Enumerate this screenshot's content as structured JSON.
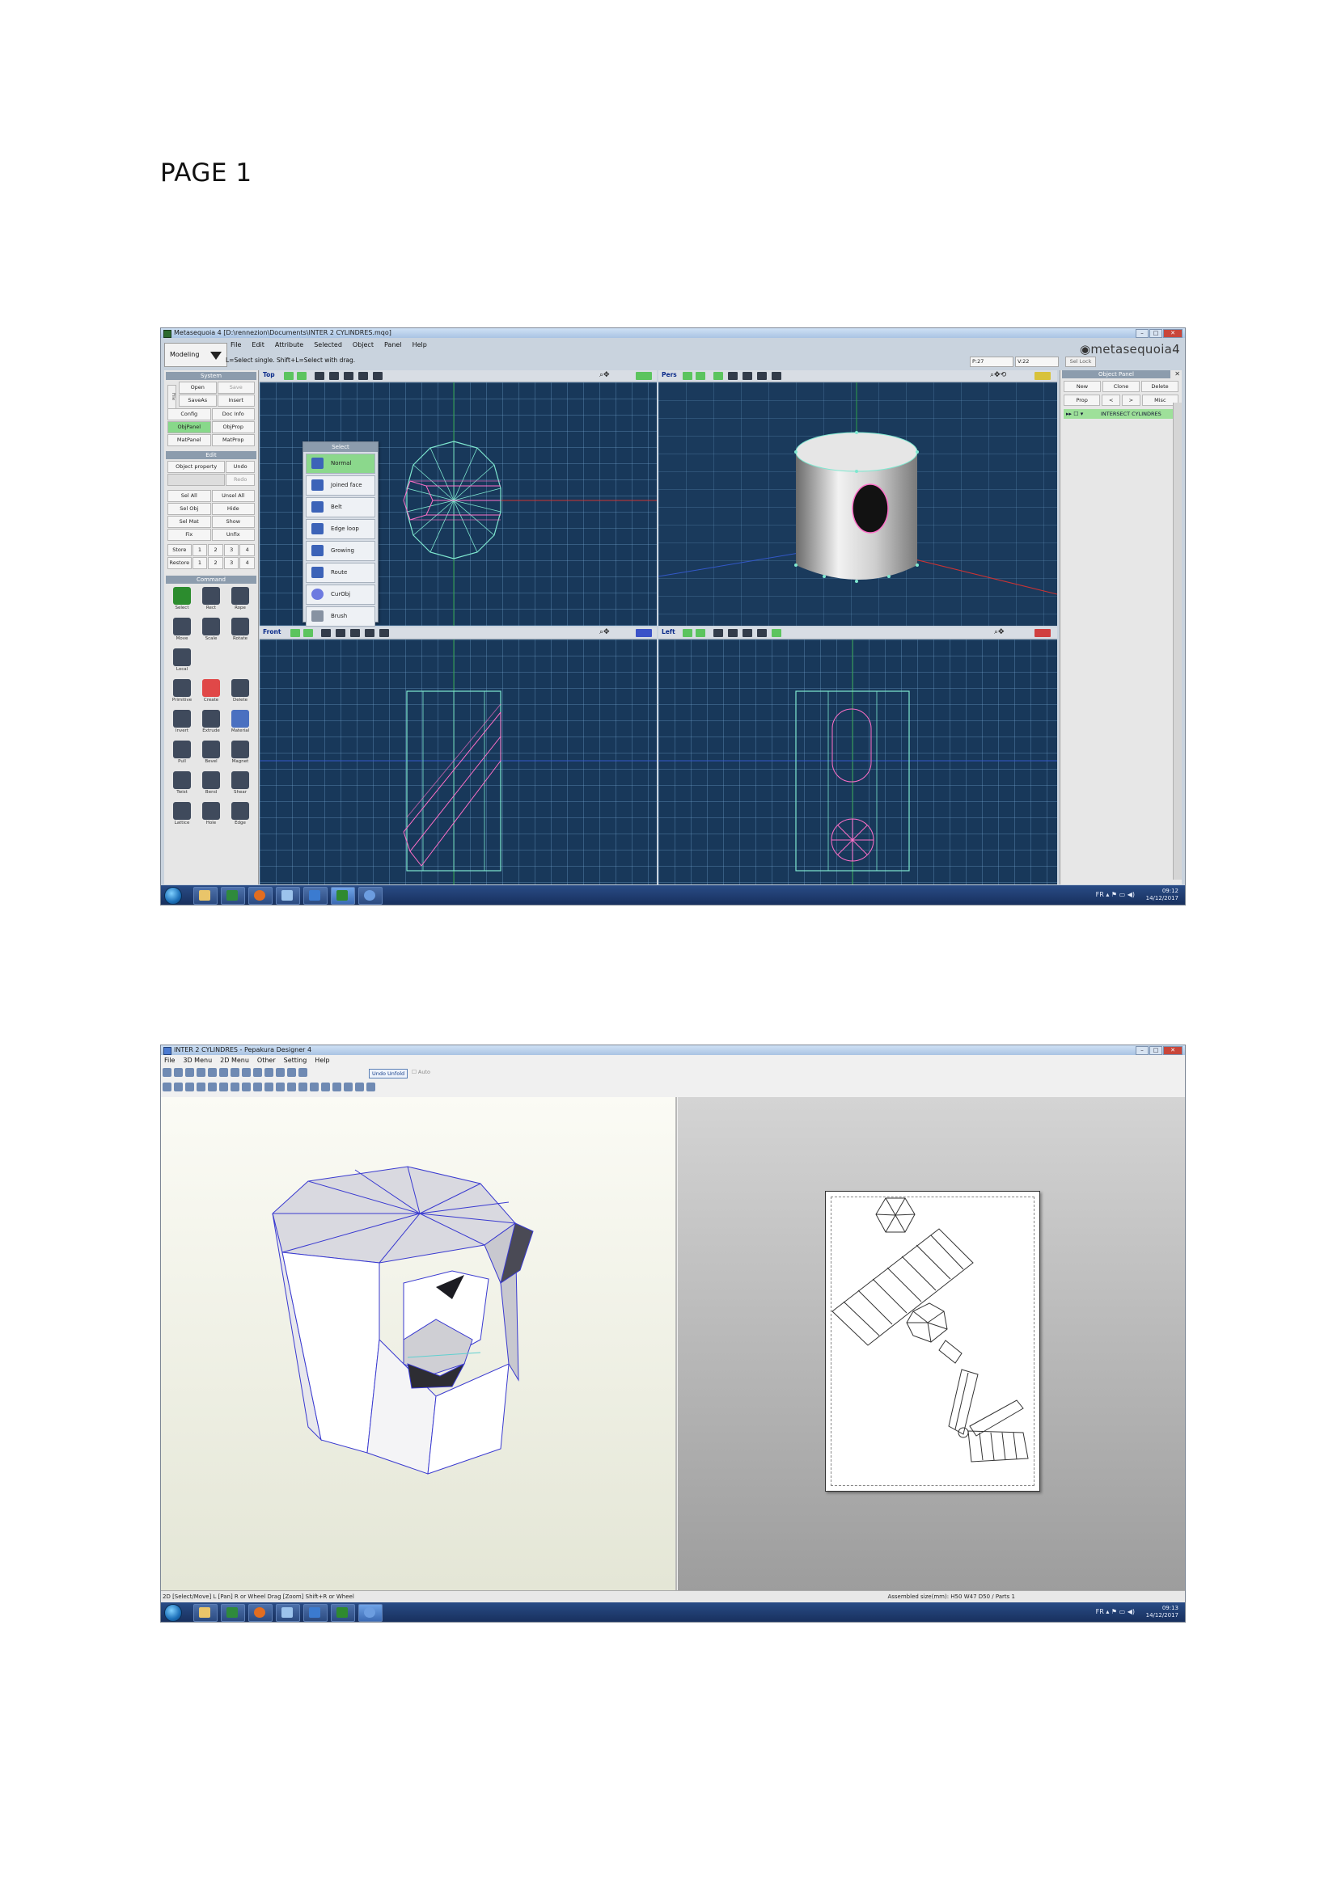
{
  "page": {
    "label": "PAGE 1"
  },
  "metasequoia": {
    "title": "Metasequoia 4 [D:\\rennezion\\Documents\\INTER 2 CYLINDRES.mqo]",
    "menu": [
      "File",
      "Edit",
      "Attribute",
      "Selected",
      "Object",
      "Panel",
      "Help"
    ],
    "mode": "Modeling",
    "status": "L=Select single.  Shift+L=Select with drag.",
    "coord_p": "P:27",
    "coord_v": "V:22",
    "sel_lock": "Sel Lock",
    "logo": "metasequoia",
    "logo_version": "4",
    "system": {
      "head": "System",
      "file_label": "File",
      "buttons": [
        "Open",
        "Save",
        "SaveAs",
        "Insert",
        "Config",
        "Doc Info",
        "ObjPanel",
        "ObjProp",
        "MatPanel",
        "MatProp"
      ]
    },
    "edit": {
      "head": "Edit",
      "buttons": [
        "Object property",
        "Undo",
        "",
        "Redo",
        "Sel All",
        "Unsel All",
        "Sel Obj",
        "Hide",
        "Sel Mat",
        "Show",
        "Fix",
        "Unfix"
      ],
      "store_label": "Store",
      "restore_label": "Restore",
      "slots": [
        "1",
        "2",
        "3",
        "4"
      ]
    },
    "command": {
      "head": "Command",
      "tools": [
        "Select",
        "Rect",
        "Rope",
        "Move",
        "Scale",
        "Rotate",
        "Local",
        "",
        "",
        "Primitive",
        "Create",
        "Delete",
        "Invert",
        "Extrude",
        "Material",
        "Pull",
        "Bevel",
        "Magnet",
        "Twist",
        "Bend",
        "Shear",
        "Lattice",
        "Hole",
        "Edge"
      ]
    },
    "viewports": {
      "top": "Top",
      "pers": "Pers",
      "front": "Front",
      "left": "Left"
    },
    "select_menu": {
      "head": "Select",
      "items": [
        "Normal",
        "Joined face",
        "Belt",
        "Edge loop",
        "Growing",
        "Route",
        "CurObj",
        "Brush"
      ]
    },
    "object_panel": {
      "head": "Object Panel",
      "row1": [
        "New",
        "Clone",
        "Delete"
      ],
      "row2": [
        "Prop",
        "<",
        ">",
        "Misc"
      ],
      "object_name": "INTERSECT CYLINDRES"
    }
  },
  "pepakura": {
    "title": "INTER 2 CYLINDRES - Pepakura Designer 4",
    "menu": [
      "File",
      "3D Menu",
      "2D Menu",
      "Other",
      "Setting",
      "Help"
    ],
    "undo_unfold": "Undo Unfold",
    "auto": "Auto",
    "status_left": "2D [Select/Move] L [Pan] R or Wheel Drag [Zoom] Shift+R or Wheel",
    "status_right": "Assembled size(mm): H50 W47 D50 / Parts 1"
  },
  "taskbar": {
    "lang": "FR",
    "time1": "09:12",
    "time2": "09:13",
    "date": "14/12/2017"
  },
  "colors": {
    "viewport_bg": "#18385a",
    "selected_green": "#88d88a",
    "wire_cyan": "#7fe8d0",
    "wire_pink": "#ff6fc8",
    "pepakura_edge": "#3a3ad0"
  }
}
